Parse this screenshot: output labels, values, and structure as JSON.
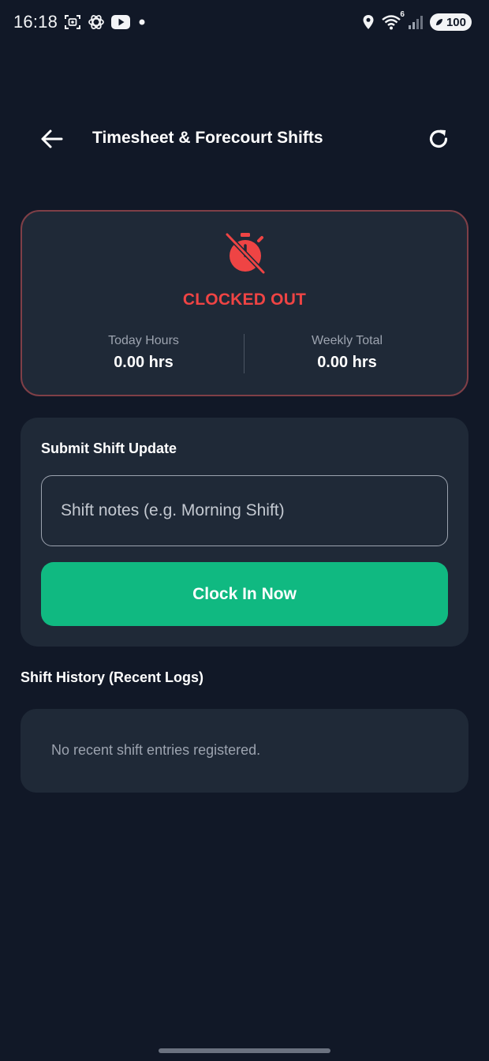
{
  "status_bar": {
    "time": "16:18",
    "left_icons": [
      "screenshot-icon",
      "chatgpt-icon",
      "youtube-icon",
      "notification-dot-icon"
    ],
    "right_icons": [
      "location-icon",
      "wifi-icon",
      "signal-icon"
    ],
    "wifi_badge": "6",
    "battery": "100"
  },
  "header": {
    "title": "Timesheet & Forecourt Shifts",
    "back_icon": "arrow-left-icon",
    "refresh_icon": "refresh-icon"
  },
  "status_card": {
    "icon": "timer-off-icon",
    "status": "CLOCKED OUT",
    "status_color": "#ef4444",
    "today_label": "Today Hours",
    "today_value": "0.00 hrs",
    "weekly_label": "Weekly Total",
    "weekly_value": "0.00 hrs"
  },
  "submit": {
    "title": "Submit Shift Update",
    "notes_placeholder": "Shift notes (e.g. Morning Shift)",
    "notes_value": "",
    "button_label": "Clock In Now",
    "button_color": "#10b981"
  },
  "history": {
    "title": "Shift History (Recent Logs)",
    "empty_message": "No recent shift entries registered."
  }
}
